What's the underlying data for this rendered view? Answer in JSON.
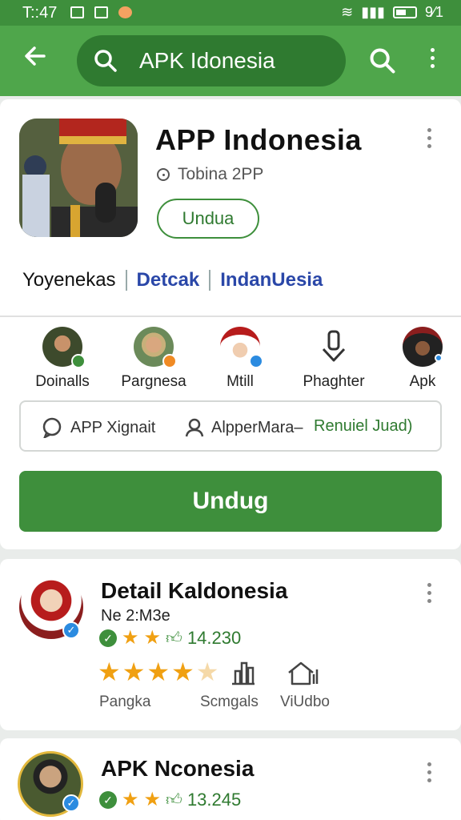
{
  "status": {
    "time": "T::47",
    "right": "9⁄1"
  },
  "search": {
    "query": "APK Idonesia"
  },
  "app": {
    "title": "APP Indonesia",
    "developer": "Tobina 2PP",
    "install_label": "Undua",
    "tags": [
      "Yoyenekas",
      "Detcak",
      "IndanUesia"
    ]
  },
  "people": [
    {
      "label": "Doinalls",
      "badge_color": "#3e8f3c"
    },
    {
      "label": "Pargnesa",
      "badge_color": "#f08a24"
    },
    {
      "label": "Mtill",
      "badge_color": "#2b8be0"
    },
    {
      "label": "Phaghter",
      "badge_color": ""
    },
    {
      "label": "Apk",
      "badge_color": "#2b8be0"
    }
  ],
  "infobar": {
    "left": "APP Xignait",
    "middle": "AlpperMara–",
    "right": "Renuiel Juad)"
  },
  "primary_button": "Undug",
  "card2": {
    "title": "Detail Kaldonesia",
    "subtitle": "Ne 2:M3e",
    "rating_count": "14.230",
    "rating_stars": 2,
    "big_rating_stars": 4,
    "stats": [
      "Pangka",
      "Scmgals",
      "ViUdbo"
    ]
  },
  "card3": {
    "title": "APK Nconesia",
    "rating_count": "13.245",
    "rating_stars": 2
  },
  "colors": {
    "brand": "#4fa64b",
    "brand_dark": "#3e8f3c",
    "link": "#2a47a8",
    "star": "#f0a012"
  }
}
